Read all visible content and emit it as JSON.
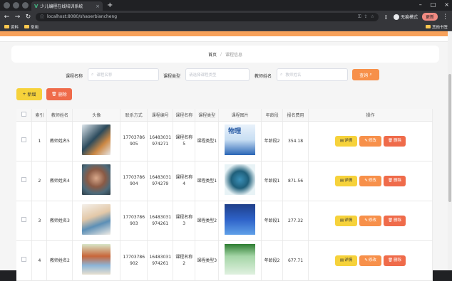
{
  "browser": {
    "tab_title": "少儿编程在线培训系统",
    "url": "localhost:8080/shaoerbiancheng",
    "profile_label": "无痕模式",
    "update_label": "更新",
    "bookmarks": [
      "资料",
      "常用"
    ],
    "other_bookmarks": "其他书签"
  },
  "breadcrumb": {
    "home": "首页",
    "sep": "/",
    "current": "课程信息"
  },
  "search": {
    "course_name_label": "课程名称",
    "course_name_placeholder": "课程名称",
    "course_type_label": "课程类型",
    "course_type_placeholder": "请选择课程类型",
    "teacher_label": "教师姓名",
    "teacher_placeholder": "教师姓名",
    "search_button": "查询"
  },
  "toolbar": {
    "add_label": "新增",
    "delete_label": "删除"
  },
  "table": {
    "headers": [
      "索引",
      "教师姓名",
      "头像",
      "联系方式",
      "课程编号",
      "课程名称",
      "课程类型",
      "课程图片",
      "年龄段",
      "报名费用",
      "操作"
    ],
    "rows": [
      {
        "index": "1",
        "teacher": "教师姓名5",
        "phone": "17703786905",
        "code": "16483031974271",
        "course": "课程名称5",
        "type": "课程类型1",
        "age": "年龄段2",
        "fee": "354.18"
      },
      {
        "index": "2",
        "teacher": "教师姓名4",
        "phone": "17703786904",
        "code": "16483031974279",
        "course": "课程名称4",
        "type": "课程类型1",
        "age": "年龄段1",
        "fee": "871.56"
      },
      {
        "index": "3",
        "teacher": "教师姓名3",
        "phone": "17703786903",
        "code": "16483031974261",
        "course": "课程名称3",
        "type": "课程类型2",
        "age": "年龄段1",
        "fee": "277.32"
      },
      {
        "index": "4",
        "teacher": "教师姓名2",
        "phone": "17703786902",
        "code": "16483031974261",
        "course": "课程名称2",
        "type": "课程类型3",
        "age": "年龄段2",
        "fee": "677.71"
      }
    ],
    "detail_label": "详情",
    "modify_label": "修改",
    "delete_label": "删除",
    "cover_text_1": "物理"
  },
  "colors": {
    "accent_orange": "#f7904a",
    "yellow": "#f6d23b",
    "red": "#ef6b4a"
  }
}
